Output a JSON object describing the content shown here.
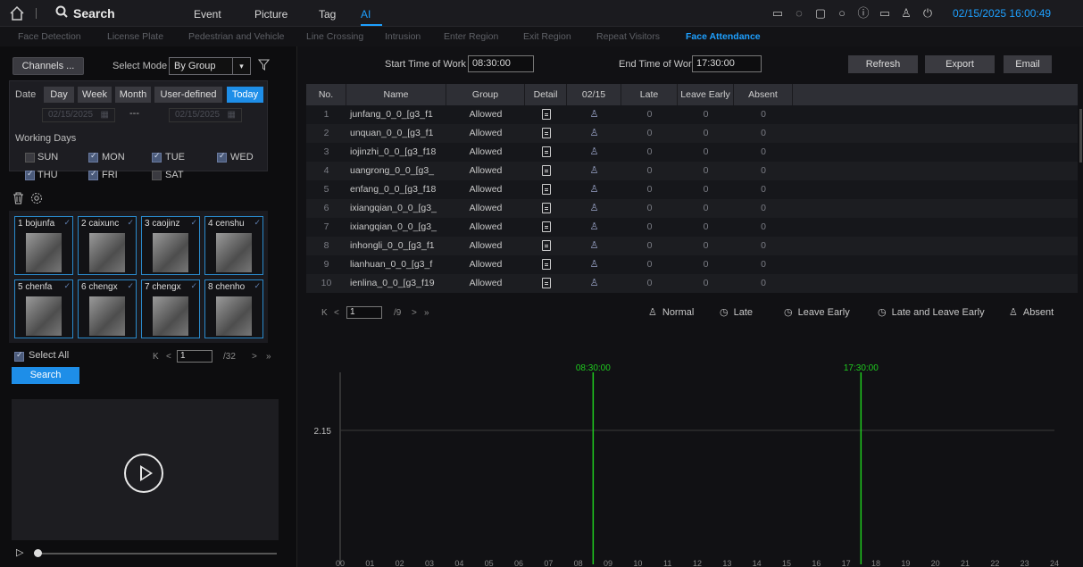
{
  "topbar": {
    "search_label": "Search",
    "tabs": [
      "Event",
      "Picture",
      "Tag",
      "AI"
    ],
    "datetime": "02/15/2025 16:00:49"
  },
  "subtabs": [
    "Face Detection",
    "License Plate",
    "Pedestrian and Vehicle",
    "Line Crossing",
    "Intrusion",
    "Enter Region",
    "Exit Region",
    "Repeat Visitors",
    "Face Attendance"
  ],
  "left": {
    "channels_button": "Channels ...",
    "select_mode_label": "Select Mode",
    "select_mode_value": "By Group",
    "date_label": "Date",
    "date_tabs": [
      "Day",
      "Week",
      "Month",
      "User-defined",
      "Today"
    ],
    "start_date": "02/15/2025",
    "end_date": "02/15/2025",
    "range_sep": "---",
    "working_days_label": "Working Days",
    "days": [
      {
        "label": "SUN",
        "checked": false
      },
      {
        "label": "MON",
        "checked": true
      },
      {
        "label": "TUE",
        "checked": true
      },
      {
        "label": "WED",
        "checked": true
      },
      {
        "label": "THU",
        "checked": true
      },
      {
        "label": "FRI",
        "checked": true
      },
      {
        "label": "SAT",
        "checked": false
      }
    ],
    "faces": [
      "1 bojunfa",
      "2 caixunc",
      "3 caojinz",
      "4 censhu",
      "5 chenfa",
      "6 chengx",
      "7 chengx",
      "8 chenho"
    ],
    "select_all": "Select All",
    "page_current": "1",
    "page_total": "/32",
    "search_button": "Search"
  },
  "right": {
    "start_time_label": "Start Time of Work",
    "start_time": "08:30:00",
    "end_time_label": "End Time of Work",
    "end_time": "17:30:00",
    "buttons": [
      "Refresh",
      "Export",
      "Email"
    ],
    "columns": [
      "No.",
      "Name",
      "Group",
      "Detail",
      "02/15",
      "Late",
      "Leave Early",
      "Absent"
    ],
    "rows": [
      {
        "no": "1",
        "name": "junfang_0_0_[g3_f1",
        "group": "Allowed",
        "late": "0",
        "early": "0",
        "absent": "0"
      },
      {
        "no": "2",
        "name": "unquan_0_0_[g3_f1",
        "group": "Allowed",
        "late": "0",
        "early": "0",
        "absent": "0"
      },
      {
        "no": "3",
        "name": "iojinzhi_0_0_[g3_f18",
        "group": "Allowed",
        "late": "0",
        "early": "0",
        "absent": "0"
      },
      {
        "no": "4",
        "name": "uangrong_0_0_[g3_",
        "group": "Allowed",
        "late": "0",
        "early": "0",
        "absent": "0"
      },
      {
        "no": "5",
        "name": "enfang_0_0_[g3_f18",
        "group": "Allowed",
        "late": "0",
        "early": "0",
        "absent": "0"
      },
      {
        "no": "6",
        "name": "ixiangqian_0_0_[g3_",
        "group": "Allowed",
        "late": "0",
        "early": "0",
        "absent": "0"
      },
      {
        "no": "7",
        "name": "ixiangqian_0_0_[g3_",
        "group": "Allowed",
        "late": "0",
        "early": "0",
        "absent": "0"
      },
      {
        "no": "8",
        "name": "inhongli_0_0_[g3_f1",
        "group": "Allowed",
        "late": "0",
        "early": "0",
        "absent": "0"
      },
      {
        "no": "9",
        "name": "lianhuan_0_0_[g3_f",
        "group": "Allowed",
        "late": "0",
        "early": "0",
        "absent": "0"
      },
      {
        "no": "10",
        "name": "ienlina_0_0_[g3_f19",
        "group": "Allowed",
        "late": "0",
        "early": "0",
        "absent": "0"
      }
    ],
    "page_current": "1",
    "page_total": "/9",
    "legend": [
      "Normal",
      "Late",
      "Leave Early",
      "Late and Leave Early",
      "Absent"
    ]
  },
  "chart_data": {
    "type": "line",
    "y_tick": "2.15",
    "x_ticks": [
      "00",
      "01",
      "02",
      "03",
      "04",
      "05",
      "06",
      "07",
      "08",
      "09",
      "10",
      "11",
      "12",
      "13",
      "14",
      "15",
      "16",
      "17",
      "18",
      "19",
      "20",
      "21",
      "22",
      "23",
      "24"
    ],
    "markers": [
      {
        "label": "08:30:00",
        "x": 8.5,
        "color": "#1fcc1f"
      },
      {
        "label": "17:30:00",
        "x": 17.5,
        "color": "#1fcc1f"
      }
    ],
    "xlim": [
      0,
      24
    ]
  }
}
